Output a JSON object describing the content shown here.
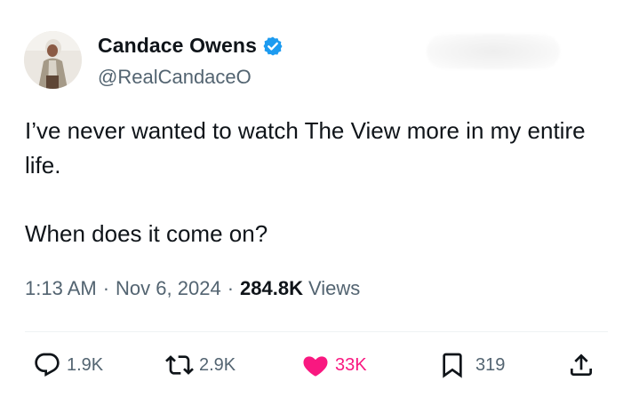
{
  "author": {
    "display_name": "Candace Owens",
    "handle": "@RealCandaceO",
    "verified": true,
    "verified_icon": "verified-badge-icon"
  },
  "tweet": {
    "paragraphs": [
      "I’ve never wanted to watch The View more in my entire life.",
      "When does it come on?"
    ],
    "time": "1:13 AM",
    "date": "Nov 6, 2024",
    "separator": "·",
    "views_count": "284.8K",
    "views_label": "Views"
  },
  "actions": {
    "reply": {
      "icon": "reply-icon",
      "count": "1.9K"
    },
    "retweet": {
      "icon": "retweet-icon",
      "count": "2.9K"
    },
    "like": {
      "icon": "heart-icon",
      "count": "33K",
      "liked": true
    },
    "bookmark": {
      "icon": "bookmark-icon",
      "count": "319"
    },
    "share": {
      "icon": "share-icon"
    }
  },
  "colors": {
    "text_primary": "#0f1419",
    "text_secondary": "#536471",
    "verified_blue": "#1d9bf0",
    "like_pink": "#f91880",
    "divider": "#eff3f4"
  }
}
